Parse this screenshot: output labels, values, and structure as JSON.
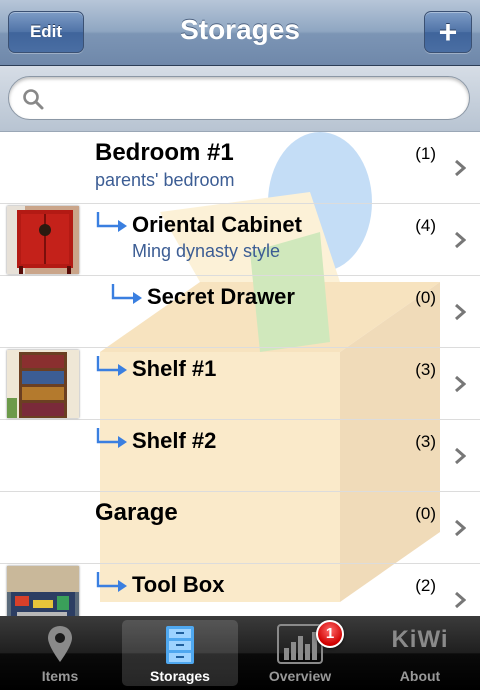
{
  "navbar": {
    "title": "Storages",
    "edit_label": "Edit",
    "add_label": "+"
  },
  "search": {
    "placeholder": "",
    "value": ""
  },
  "rows": [
    {
      "title": "Bedroom #1",
      "subtitle": "parents' bedroom",
      "count": "(1)",
      "thumb": "none",
      "indent": 0
    },
    {
      "title": "Oriental Cabinet",
      "subtitle": "Ming dynasty style",
      "count": "(4)",
      "thumb": "red-cabinet",
      "indent": 1
    },
    {
      "title": "Secret Drawer",
      "subtitle": "",
      "count": "(0)",
      "thumb": "none",
      "indent": 2
    },
    {
      "title": "Shelf #1",
      "subtitle": "",
      "count": "(3)",
      "thumb": "bookshelf",
      "indent": 1
    },
    {
      "title": "Shelf #2",
      "subtitle": "",
      "count": "(3)",
      "thumb": "none",
      "indent": 1
    },
    {
      "title": "Garage",
      "subtitle": "",
      "count": "(0)",
      "thumb": "none",
      "indent": 0
    },
    {
      "title": "Tool Box",
      "subtitle": "",
      "count": "(2)",
      "thumb": "toolbox",
      "indent": 1
    }
  ],
  "tabbar": {
    "tabs": [
      {
        "label": "Items",
        "icon": "map-pin-icon",
        "active": false
      },
      {
        "label": "Storages",
        "icon": "cabinet-icon",
        "active": true
      },
      {
        "label": "Overview",
        "icon": "bar-chart-icon",
        "active": false,
        "badge": "1"
      },
      {
        "label": "About",
        "icon": "kiwi-logo",
        "active": false,
        "logo_text": "KiWi"
      }
    ]
  },
  "colors": {
    "subtitle": "#3c5d94",
    "arrow": "#3a7fe0",
    "navbar": "#7c95b5"
  }
}
